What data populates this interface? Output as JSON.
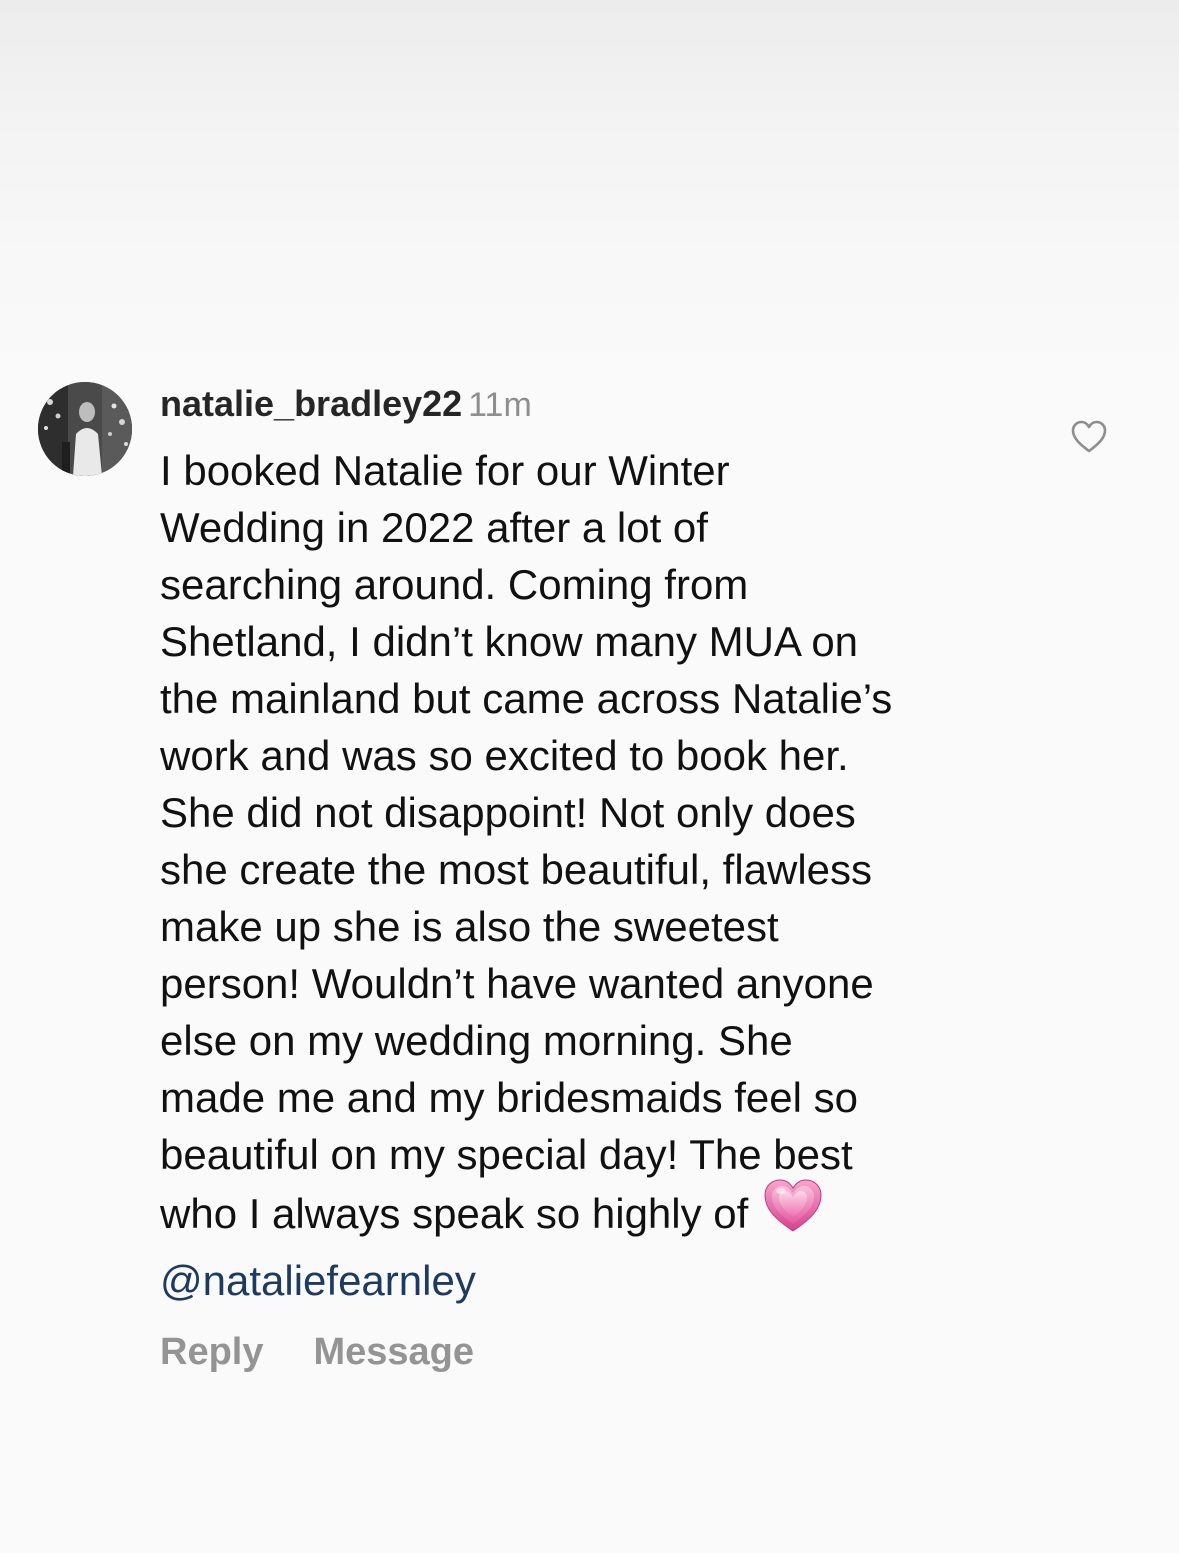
{
  "comment": {
    "username": "natalie_bradley22",
    "timestamp": "11m",
    "text_lines": [
      "I booked Natalie for our Winter",
      "Wedding in 2022 after a lot of",
      "searching around. Coming from",
      "Shetland, I didn’t know many MUA on",
      "the mainland but came across Natalie’s",
      "work and was so excited to book her.",
      "She did not disappoint! Not only does",
      "she create the most beautiful, flawless",
      "make up she is also the sweetest",
      "person! Wouldn’t have wanted anyone",
      "else on my wedding morning. She",
      "made me and my bridesmaids feel so",
      "beautiful on my special day! The best",
      "who I always speak so highly of"
    ],
    "emoji": "growing-heart",
    "mention": "@nataliefearnley",
    "actions": {
      "reply": "Reply",
      "message": "Message"
    },
    "like_icon": "heart-outline-icon"
  },
  "colors": {
    "username": "#262626",
    "timestamp": "#8e8e8e",
    "mention": "#1d3a63",
    "action": "#949494"
  }
}
